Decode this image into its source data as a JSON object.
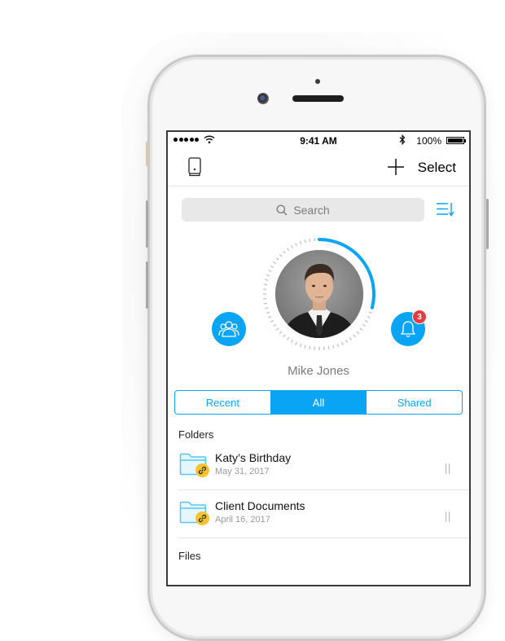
{
  "status_bar": {
    "signal_icon": "signal-dots-icon",
    "wifi_icon": "wifi-icon",
    "time": "9:41 AM",
    "bluetooth_icon": "bluetooth-icon",
    "battery_percent": "100%",
    "battery_icon": "battery-icon"
  },
  "nav": {
    "left_icon": "device-icon",
    "add_icon": "plus-icon",
    "select_label": "Select"
  },
  "search": {
    "placeholder": "Search",
    "icon": "search-icon"
  },
  "sort_icon": "sort-icon",
  "profile": {
    "name": "Mike Jones",
    "storage_progress": 0.29,
    "left_action_icon": "people-icon",
    "right_action_icon": "bell-icon",
    "notification_count": "3"
  },
  "colors": {
    "accent": "#0aa4f5",
    "badge": "#e8393f",
    "link_badge": "#f7c431",
    "folder": "#56c6f0"
  },
  "tabs": [
    {
      "label": "Recent",
      "active": false
    },
    {
      "label": "All",
      "active": true
    },
    {
      "label": "Shared",
      "active": false
    }
  ],
  "sections": {
    "folders_label": "Folders",
    "files_label": "Files"
  },
  "folders": [
    {
      "name": "Katy’s Birthday",
      "date": "May 31, 2017",
      "shared": true
    },
    {
      "name": "Client Documents",
      "date": "April 16, 2017",
      "shared": true
    }
  ]
}
